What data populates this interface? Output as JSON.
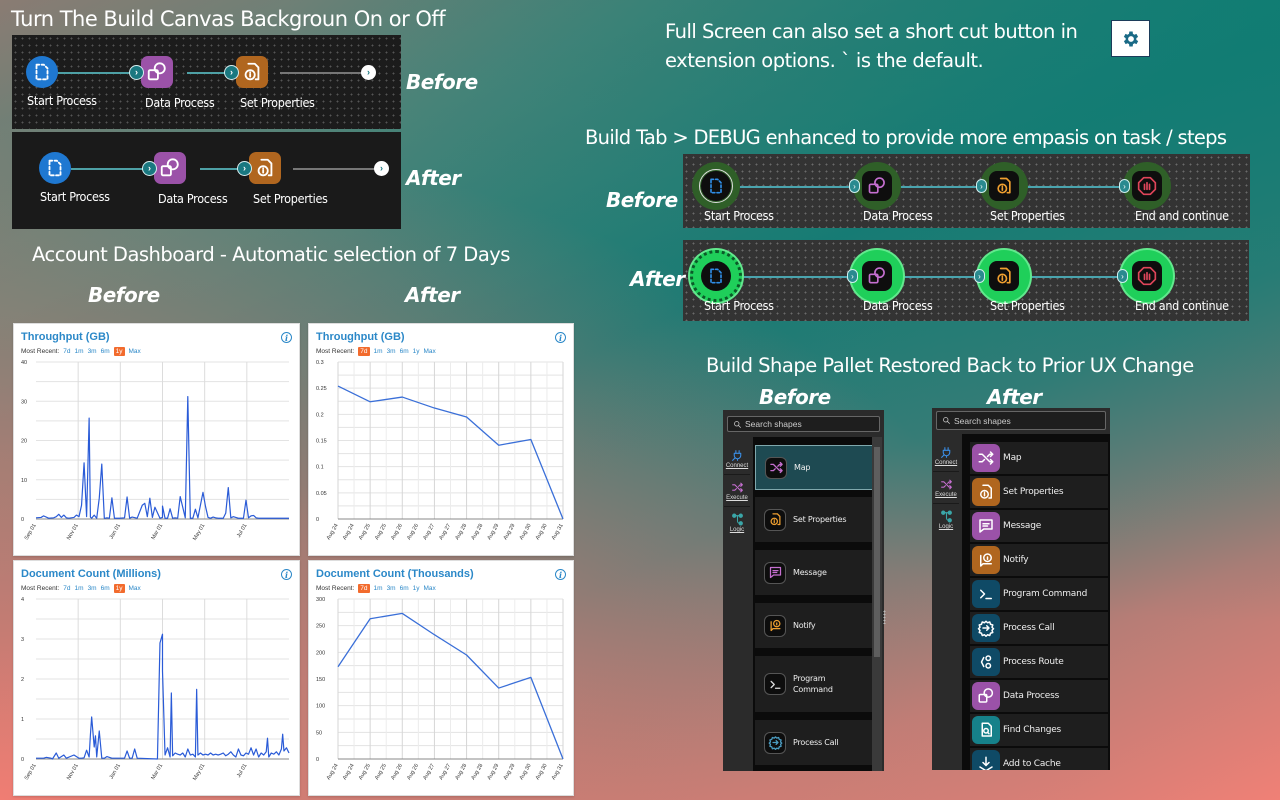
{
  "sections": {
    "canvas_bg": {
      "title": "Turn The Build Canvas Backgroun On or Off",
      "before_label": "Before",
      "after_label": "After",
      "nodes": [
        {
          "label": "Start Process",
          "icon": "start-process-icon",
          "color": "#1f78d1"
        },
        {
          "label": "Data Process",
          "icon": "data-process-icon",
          "color": "#9b52a8"
        },
        {
          "label": "Set Properties",
          "icon": "set-properties-icon",
          "color": "#b0661f"
        }
      ]
    },
    "fullscreen": {
      "line1": "Full Screen can also set a short cut button in",
      "line2": "extension options. ` is the default.",
      "button_icon": "gear-icon"
    },
    "debug": {
      "title": "Build Tab > DEBUG enhanced to provide more empasis on task / steps",
      "before_label": "Before",
      "after_label": "After",
      "nodes": [
        {
          "label": "Start Process",
          "icon": "start-process-icon",
          "color": "#2f8de6"
        },
        {
          "label": "Data Process",
          "icon": "data-process-icon",
          "color": "#c56fd0"
        },
        {
          "label": "Set Properties",
          "icon": "set-properties-icon",
          "color": "#f0a030"
        },
        {
          "label": "End and continue",
          "icon": "stop-hand-icon",
          "color": "#e0455a"
        }
      ]
    },
    "dashboard": {
      "title": "Account Dashboard - Automatic selection of 7 Days",
      "before_label": "Before",
      "after_label": "After",
      "most_recent_label": "Most Recent:",
      "range_options": [
        "7d",
        "1m",
        "3m",
        "6m",
        "1y",
        "Max"
      ],
      "info_icon": "info-icon"
    },
    "palette": {
      "title": "Build Shape Pallet Restored Back to Prior UX Change",
      "before_label": "Before",
      "after_label": "After",
      "search_placeholder": "Search shapes",
      "categories": [
        {
          "label": "Connect",
          "icon": "plug-icon",
          "color": "#3a8ee6"
        },
        {
          "label": "Execute",
          "icon": "shuffle-icon",
          "color": "#c56fd0"
        },
        {
          "label": "Logic",
          "icon": "branch-icon",
          "color": "#3aa6a8"
        }
      ],
      "before_items": [
        {
          "label": "Map",
          "icon": "shuffle-icon",
          "color": "#c56fd0"
        },
        {
          "label": "Set Properties",
          "icon": "set-properties-icon",
          "color": "#f0a030"
        },
        {
          "label": "Message",
          "icon": "message-icon",
          "color": "#c56fd0"
        },
        {
          "label": "Notify",
          "icon": "notify-icon",
          "color": "#f0a030"
        },
        {
          "label": "Program Command",
          "icon": "terminal-icon",
          "color": "#dddddd"
        },
        {
          "label": "Process Call",
          "icon": "process-call-icon",
          "color": "#4a9bc0"
        }
      ],
      "after_items": [
        {
          "label": "Map",
          "icon": "shuffle-icon",
          "bg": "#9b52a8"
        },
        {
          "label": "Set Properties",
          "icon": "set-properties-icon",
          "bg": "#b0661f"
        },
        {
          "label": "Message",
          "icon": "message-icon",
          "bg": "#9b52a8"
        },
        {
          "label": "Notify",
          "icon": "notify-icon",
          "bg": "#b0661f"
        },
        {
          "label": "Program Command",
          "icon": "terminal-icon",
          "bg": "#0f4a66"
        },
        {
          "label": "Process Call",
          "icon": "process-call-icon",
          "bg": "#0f4a66"
        },
        {
          "label": "Process Route",
          "icon": "process-route-icon",
          "bg": "#0f4a66"
        },
        {
          "label": "Data Process",
          "icon": "data-process-icon",
          "bg": "#9b52a8"
        },
        {
          "label": "Find Changes",
          "icon": "find-changes-icon",
          "bg": "#16818a"
        },
        {
          "label": "Add to Cache",
          "icon": "add-to-cache-icon",
          "bg": "#0f4a66"
        }
      ]
    }
  },
  "chart_data": [
    {
      "id": "throughput_before",
      "type": "line",
      "title": "Throughput (GB)",
      "selected_range": "1y",
      "xlabel": "",
      "ylabel": "",
      "x_ticks": [
        "Sep 01",
        "Nov 01",
        "Jan 01",
        "Mar 01",
        "May 01",
        "Jul 01"
      ],
      "ylim": [
        0,
        40
      ],
      "y_ticks": [
        0,
        10,
        20,
        30,
        40
      ],
      "grid": true,
      "series": [
        {
          "name": "Throughput",
          "color": "#2a5bd7",
          "x_frac": [
            0,
            0.02,
            0.03,
            0.05,
            0.07,
            0.08,
            0.09,
            0.1,
            0.11,
            0.12,
            0.13,
            0.15,
            0.16,
            0.17,
            0.18,
            0.19,
            0.2,
            0.21,
            0.215,
            0.22,
            0.225,
            0.23,
            0.24,
            0.25,
            0.26,
            0.27,
            0.275,
            0.28,
            0.29,
            0.3,
            0.31,
            0.32,
            0.33,
            0.35,
            0.36,
            0.37,
            0.38,
            0.4,
            0.42,
            0.43,
            0.44,
            0.45,
            0.46,
            0.47,
            0.49,
            0.5,
            0.5,
            0.51,
            0.52,
            0.53,
            0.54,
            0.55,
            0.56,
            0.57,
            0.59,
            0.6,
            0.61,
            0.62,
            0.63,
            0.64,
            0.66,
            0.67,
            0.68,
            0.69,
            0.7,
            0.71,
            0.72,
            0.73,
            0.74,
            0.75,
            0.76,
            0.77,
            0.78,
            0.79,
            0.8,
            0.82,
            0.83,
            0.84,
            0.85,
            0.86,
            0.87,
            0.88,
            0.9,
            0.91,
            0.92,
            0.93,
            0.94,
            0.95,
            0.97,
            1.0
          ],
          "values": [
            0.3,
            0.4,
            0.8,
            0.2,
            0.3,
            0.6,
            1.2,
            0.4,
            1.0,
            0.3,
            0.2,
            0.4,
            1.0,
            0.6,
            3.5,
            14.3,
            0.6,
            25.7,
            0.5,
            0.2,
            0.6,
            1.0,
            0.2,
            5.3,
            14.0,
            0.2,
            0.2,
            0.3,
            0.2,
            5.4,
            0.2,
            0.2,
            0.2,
            0.3,
            5.6,
            0.2,
            0.5,
            0.2,
            3.5,
            4.0,
            0.6,
            5.3,
            0.4,
            3.0,
            0.2,
            0.4,
            3.3,
            0.2,
            0.2,
            2.6,
            0.2,
            0.3,
            0.2,
            5.7,
            0.3,
            31.2,
            0.2,
            0.2,
            2.5,
            0.3,
            6.8,
            3.2,
            0.4,
            0.2,
            0.5,
            0.3,
            0.2,
            0.2,
            0.2,
            1.5,
            8.0,
            0.3,
            0.6,
            0.4,
            0.2,
            0.2,
            4.8,
            0.3,
            0.8,
            0.9,
            0.3,
            0.2,
            0.2,
            0.2,
            0.2,
            0.2,
            0.2,
            0.2,
            0.2,
            0.2
          ]
        }
      ]
    },
    {
      "id": "throughput_after",
      "type": "line",
      "title": "Throughput (GB)",
      "selected_range": "7d",
      "xlabel": "",
      "ylabel": "",
      "x_ticks": [
        "Aug 24",
        "Aug 24",
        "Aug 25",
        "Aug 25",
        "Aug 26",
        "Aug 26",
        "Aug 27",
        "Aug 27",
        "Aug 28",
        "Aug 28",
        "Aug 29",
        "Aug 29",
        "Aug 30",
        "Aug 30",
        "Aug 31"
      ],
      "ylim": [
        0,
        0.3
      ],
      "y_ticks": [
        0,
        0.05,
        0.1,
        0.15,
        0.2,
        0.25,
        0.3
      ],
      "grid": true,
      "series": [
        {
          "name": "Throughput",
          "color": "#3a6fd8",
          "x": [
            "Aug 24",
            "Aug 25",
            "Aug 26",
            "Aug 27",
            "Aug 28",
            "Aug 29",
            "Aug 30",
            "Aug 31"
          ],
          "values": [
            0.254,
            0.224,
            0.233,
            0.212,
            0.195,
            0.141,
            0.152,
            0.0
          ]
        }
      ]
    },
    {
      "id": "doccount_before",
      "type": "line",
      "title": "Document Count (Millions)",
      "selected_range": "1y",
      "xlabel": "",
      "ylabel": "",
      "x_ticks": [
        "Sep 01",
        "Nov 01",
        "Jan 01",
        "Mar 01",
        "May 01",
        "Jul 01"
      ],
      "ylim": [
        0,
        4
      ],
      "y_ticks": [
        0,
        1,
        2,
        3,
        4
      ],
      "grid": true,
      "series": [
        {
          "name": "Document Count",
          "color": "#2a5bd7",
          "x_frac": [
            0,
            0.03,
            0.04,
            0.06,
            0.065,
            0.08,
            0.09,
            0.11,
            0.12,
            0.15,
            0.17,
            0.18,
            0.19,
            0.2,
            0.21,
            0.215,
            0.22,
            0.23,
            0.235,
            0.24,
            0.25,
            0.26,
            0.27,
            0.28,
            0.3,
            0.35,
            0.36,
            0.37,
            0.38,
            0.39,
            0.4,
            0.48,
            0.49,
            0.5,
            0.5,
            0.51,
            0.52,
            0.53,
            0.535,
            0.54,
            0.55,
            0.56,
            0.57,
            0.58,
            0.59,
            0.6,
            0.61,
            0.62,
            0.63,
            0.635,
            0.64,
            0.65,
            0.66,
            0.67,
            0.68,
            0.69,
            0.7,
            0.71,
            0.72,
            0.73,
            0.74,
            0.75,
            0.76,
            0.77,
            0.78,
            0.79,
            0.8,
            0.81,
            0.82,
            0.83,
            0.84,
            0.85,
            0.86,
            0.87,
            0.88,
            0.89,
            0.9,
            0.91,
            0.915,
            0.92,
            0.93,
            0.94,
            0.95,
            0.96,
            0.97,
            0.975,
            0.98,
            0.99,
            1.0
          ],
          "values": [
            0.02,
            0.02,
            0.04,
            0.02,
            0.0,
            0.15,
            0.02,
            0.1,
            0.02,
            0.1,
            0.02,
            0.02,
            0.03,
            0.22,
            0.05,
            0.6,
            1.05,
            0.3,
            0.58,
            0.05,
            0.7,
            0.02,
            0.02,
            0.06,
            0.02,
            0.02,
            0.2,
            0.02,
            0.02,
            0.25,
            0.02,
            0.0,
            2.9,
            3.12,
            2.2,
            0.1,
            0.28,
            0.05,
            1.65,
            0.08,
            0.15,
            0.12,
            0.1,
            0.15,
            0.05,
            0.25,
            0.1,
            0.12,
            0.05,
            1.74,
            0.1,
            0.15,
            0.1,
            0.12,
            0.1,
            0.15,
            0.1,
            0.12,
            0.1,
            0.12,
            0.15,
            0.08,
            0.12,
            0.18,
            0.1,
            0.05,
            0.25,
            0.1,
            0.08,
            0.15,
            0.12,
            0.28,
            0.1,
            0.25,
            0.05,
            0.15,
            0.1,
            0.18,
            0.52,
            0.05,
            0.15,
            0.12,
            0.18,
            0.1,
            0.25,
            0.62,
            0.2,
            0.28,
            0.15
          ]
        }
      ]
    },
    {
      "id": "doccount_after",
      "type": "line",
      "title": "Document Count (Thousands)",
      "selected_range": "7d",
      "xlabel": "",
      "ylabel": "",
      "x_ticks": [
        "Aug 24",
        "Aug 24",
        "Aug 25",
        "Aug 25",
        "Aug 26",
        "Aug 26",
        "Aug 27",
        "Aug 27",
        "Aug 28",
        "Aug 28",
        "Aug 29",
        "Aug 29",
        "Aug 30",
        "Aug 30",
        "Aug 31"
      ],
      "ylim": [
        0,
        300
      ],
      "y_ticks": [
        0,
        50,
        100,
        150,
        200,
        250,
        300
      ],
      "grid": true,
      "series": [
        {
          "name": "Document Count",
          "color": "#3a6fd8",
          "x": [
            "Aug 24",
            "Aug 25",
            "Aug 26",
            "Aug 27",
            "Aug 28",
            "Aug 29",
            "Aug 30",
            "Aug 31"
          ],
          "values": [
            173,
            263,
            273,
            233,
            195,
            133,
            153,
            0
          ]
        }
      ]
    }
  ]
}
